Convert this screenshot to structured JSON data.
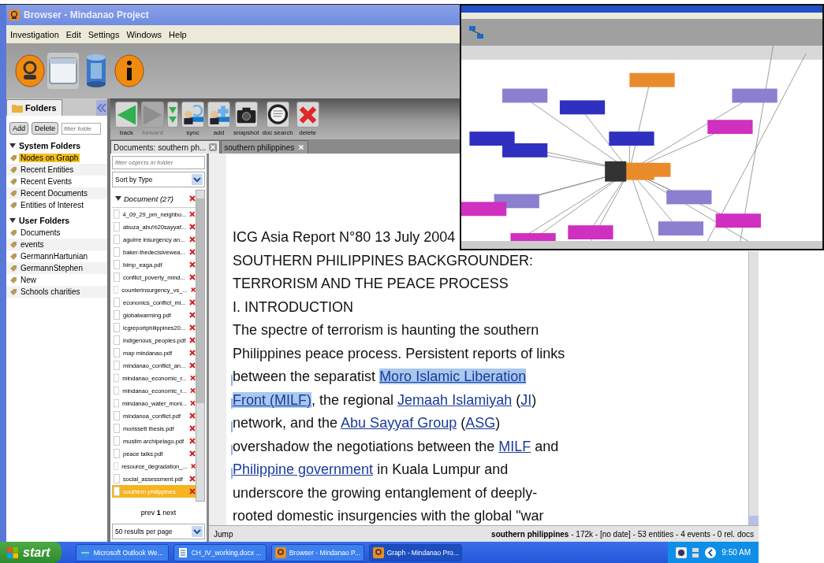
{
  "window": {
    "title": "Browser - Mindanao Project"
  },
  "menu": [
    "Investigation",
    "Edit",
    "Settings",
    "Windows",
    "Help"
  ],
  "modes": [
    {
      "kind": "analyst",
      "selected": false
    },
    {
      "kind": "browser",
      "selected": true
    },
    {
      "kind": "database",
      "selected": false
    },
    {
      "kind": "info",
      "selected": false
    }
  ],
  "folders_panel": {
    "tab": "Folders",
    "add": "Add",
    "delete": "Delete",
    "filter_placeholder": "filter folde",
    "groups": [
      {
        "label": "System Folders",
        "expanded": true,
        "items": [
          {
            "label": "Nodes on Graph",
            "selected": true
          },
          {
            "label": "Recent Entities",
            "selected": false
          },
          {
            "label": "Recent Events",
            "selected": false
          },
          {
            "label": "Recent Documents",
            "selected": false
          },
          {
            "label": "Entities of Interest",
            "selected": false
          }
        ]
      },
      {
        "label": "User Folders",
        "expanded": true,
        "items": [
          {
            "label": "Documents",
            "selected": false
          },
          {
            "label": "events",
            "selected": false
          },
          {
            "label": "GermannHartunian",
            "selected": false
          },
          {
            "label": "GermannStephen",
            "selected": false
          },
          {
            "label": "New",
            "selected": false
          },
          {
            "label": "Schools charities",
            "selected": false
          }
        ]
      }
    ]
  },
  "toolbar": [
    {
      "kind": "back",
      "label": "back",
      "disabled": false
    },
    {
      "kind": "forward",
      "label": "forward",
      "disabled": true
    },
    {
      "kind": "dropdown",
      "disabled": false
    },
    {
      "kind": "sync",
      "label": "sync",
      "disabled": false
    },
    {
      "kind": "add",
      "label": "add",
      "disabled": false
    },
    {
      "kind": "snapshot",
      "label": "snapshot",
      "disabled": false
    },
    {
      "kind": "search",
      "label": "doc search",
      "disabled": false
    },
    {
      "kind": "delete",
      "label": "delete",
      "disabled": false
    }
  ],
  "tabs": [
    {
      "label": "Documents: southern ph...",
      "selected": true
    },
    {
      "label": "southern philippines",
      "selected": false
    }
  ],
  "doc_list": {
    "filter_placeholder": "filter objects in folder",
    "sort": "Sort by Type",
    "group": "Document (27)",
    "items": [
      {
        "name": "4_09_29_pm_neighbo...",
        "selected": false
      },
      {
        "name": "abuza_abu%20sayyaf...",
        "selected": false
      },
      {
        "name": "aguirre insurgency an...",
        "selected": false
      },
      {
        "name": "baker-thedecisivewea...",
        "selected": false
      },
      {
        "name": "bimp_eaga.pdf",
        "selected": false
      },
      {
        "name": "conflict_poverty_mind...",
        "selected": false
      },
      {
        "name": "counterinsurgency_vs_...",
        "selected": false
      },
      {
        "name": "econonics_conflict_mi...",
        "selected": false
      },
      {
        "name": "globalwarming.pdf",
        "selected": false
      },
      {
        "name": "icgreportphilippines20...",
        "selected": false
      },
      {
        "name": "indigenous_peoples.pdf",
        "selected": false
      },
      {
        "name": "map mindanao.pdf",
        "selected": false
      },
      {
        "name": "mindanao_conflict_an...",
        "selected": false
      },
      {
        "name": "mindanao_economic_r...",
        "selected": false
      },
      {
        "name": "mindanao_economic_r...",
        "selected": false
      },
      {
        "name": "mindanao_water_moni...",
        "selected": false
      },
      {
        "name": "mindanoa_conflict.pdf",
        "selected": false
      },
      {
        "name": "morissett thesis.pdf",
        "selected": false
      },
      {
        "name": "muslim archipelago.pdf",
        "selected": false
      },
      {
        "name": "peace talks.pdf",
        "selected": false
      },
      {
        "name": "resource_degradation_...",
        "selected": false
      },
      {
        "name": "social_assessment.pdf",
        "selected": false
      },
      {
        "name": "southern philippines",
        "selected": true
      }
    ],
    "pager": "prev **1** next",
    "page_size": "50 results per page"
  },
  "document": {
    "lines": [
      {
        "marked": false,
        "parts": [
          {
            "kind": "text",
            "text": "ICG Asia Report N°80 13 July 2004"
          }
        ]
      },
      {
        "marked": false,
        "parts": [
          {
            "kind": "text",
            "text": "SOUTHERN PHILIPPINES BACKGROUNDER:"
          }
        ]
      },
      {
        "marked": false,
        "parts": [
          {
            "kind": "text",
            "text": "TERRORISM AND THE PEACE PROCESS"
          }
        ]
      },
      {
        "marked": false,
        "parts": [
          {
            "kind": "text",
            "text": "I. INTRODUCTION"
          }
        ]
      },
      {
        "marked": false,
        "parts": [
          {
            "kind": "text",
            "text": "The spectre of terrorism is haunting the southern"
          }
        ]
      },
      {
        "marked": false,
        "parts": [
          {
            "kind": "text",
            "text": "Philippines peace process. Persistent reports of links"
          }
        ]
      },
      {
        "marked": true,
        "parts": [
          {
            "kind": "text",
            "text": "between the separatist "
          },
          {
            "kind": "link",
            "text": "Moro Islamic Liberation",
            "highlighted": true
          }
        ]
      },
      {
        "marked": true,
        "parts": [
          {
            "kind": "link",
            "text": "Front (MILF)",
            "highlighted": true
          },
          {
            "kind": "text",
            "text": ", the regional "
          },
          {
            "kind": "link",
            "text": "Jemaah Islamiyah",
            "highlighted": false
          },
          {
            "kind": "text",
            "text": " ("
          },
          {
            "kind": "link",
            "text": "JI",
            "highlighted": false
          },
          {
            "kind": "text",
            "text": ")"
          }
        ]
      },
      {
        "marked": true,
        "parts": [
          {
            "kind": "text",
            "text": "network, and the "
          },
          {
            "kind": "link",
            "text": "Abu Sayyaf Group",
            "highlighted": false
          },
          {
            "kind": "text",
            "text": " ("
          },
          {
            "kind": "link",
            "text": "ASG",
            "highlighted": false
          },
          {
            "kind": "text",
            "text": ")"
          }
        ]
      },
      {
        "marked": true,
        "parts": [
          {
            "kind": "text",
            "text": "overshadow the negotiations between the "
          },
          {
            "kind": "link",
            "text": "MILF",
            "highlighted": false
          },
          {
            "kind": "text",
            "text": " and"
          }
        ]
      },
      {
        "marked": true,
        "parts": [
          {
            "kind": "link",
            "text": "Philippine government",
            "highlighted": false
          },
          {
            "kind": "text",
            "text": " in Kuala Lumpur and"
          }
        ]
      },
      {
        "marked": false,
        "parts": [
          {
            "kind": "text",
            "text": "underscore the growing entanglement of deeply-"
          }
        ]
      },
      {
        "marked": false,
        "parts": [
          {
            "kind": "text",
            "text": "rooted domestic insurgencies with the global \"war"
          }
        ]
      }
    ],
    "jump": "Jump",
    "status": "**southern philippines** - 172k - [no date] - 53 entities - 4 events - 0 rel. docs"
  },
  "taskbar": {
    "start": "start",
    "tasks": [
      {
        "kind": "browser",
        "label": "Microsoft Outlook We...",
        "selected": false
      },
      {
        "kind": "word",
        "label": "CH_IV_working.docx ...",
        "selected": false
      },
      {
        "kind": "app",
        "label": "Browser - Mindanao P...",
        "selected": false
      },
      {
        "kind": "app",
        "label": "Graph - Mindanao Pro...",
        "selected": true
      }
    ],
    "clock": "9:50 AM"
  }
}
